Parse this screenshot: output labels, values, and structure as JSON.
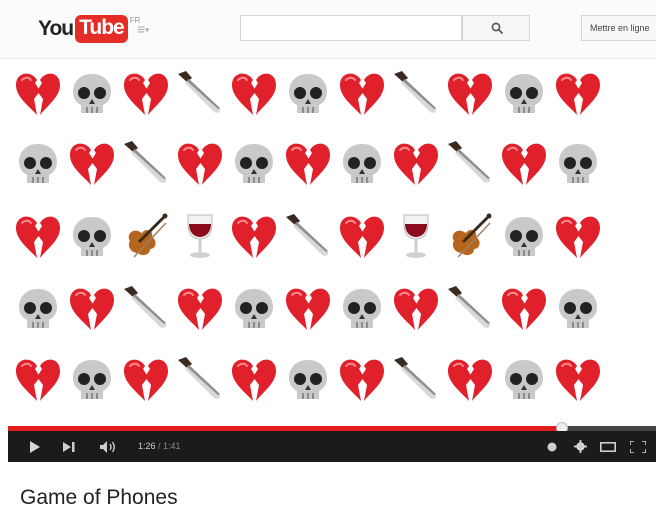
{
  "header": {
    "logo_text_you": "You",
    "logo_text_tube": "Tube",
    "logo_region": "FR",
    "search": {
      "value": "",
      "placeholder": ""
    },
    "upload_label": "Mettre en ligne",
    "icons": {
      "guide": "menu-icon",
      "search": "search-icon"
    }
  },
  "player": {
    "emoji_rows": [
      [
        "broken-heart",
        "skull",
        "broken-heart",
        "knife",
        "broken-heart",
        "skull",
        "broken-heart",
        "knife",
        "broken-heart",
        "skull",
        "broken-heart"
      ],
      [
        "skull",
        "broken-heart",
        "knife",
        "broken-heart",
        "skull",
        "broken-heart",
        "skull",
        "broken-heart",
        "knife",
        "broken-heart",
        "skull"
      ],
      [
        "broken-heart",
        "skull",
        "violin",
        "wine-glass",
        "broken-heart",
        "knife",
        "broken-heart",
        "wine-glass",
        "violin",
        "skull",
        "broken-heart"
      ],
      [
        "skull",
        "broken-heart",
        "knife",
        "broken-heart",
        "skull",
        "broken-heart",
        "skull",
        "broken-heart",
        "knife",
        "broken-heart",
        "skull"
      ],
      [
        "broken-heart",
        "skull",
        "broken-heart",
        "knife",
        "broken-heart",
        "skull",
        "broken-heart",
        "knife",
        "broken-heart",
        "skull",
        "broken-heart"
      ]
    ],
    "progress_fraction": 0.855,
    "time_current": "1:26",
    "time_total": " / 1:41",
    "colors": {
      "progress": "#e21b1b",
      "controls_bg": "#1b1b1b"
    },
    "icons": {
      "play": "play-icon",
      "next": "next-icon",
      "volume": "volume-icon",
      "annotations": "annotations-icon",
      "settings": "gear-icon",
      "theater": "theater-mode-icon",
      "fullscreen": "fullscreen-icon"
    }
  },
  "video": {
    "title": "Game of Phones"
  }
}
